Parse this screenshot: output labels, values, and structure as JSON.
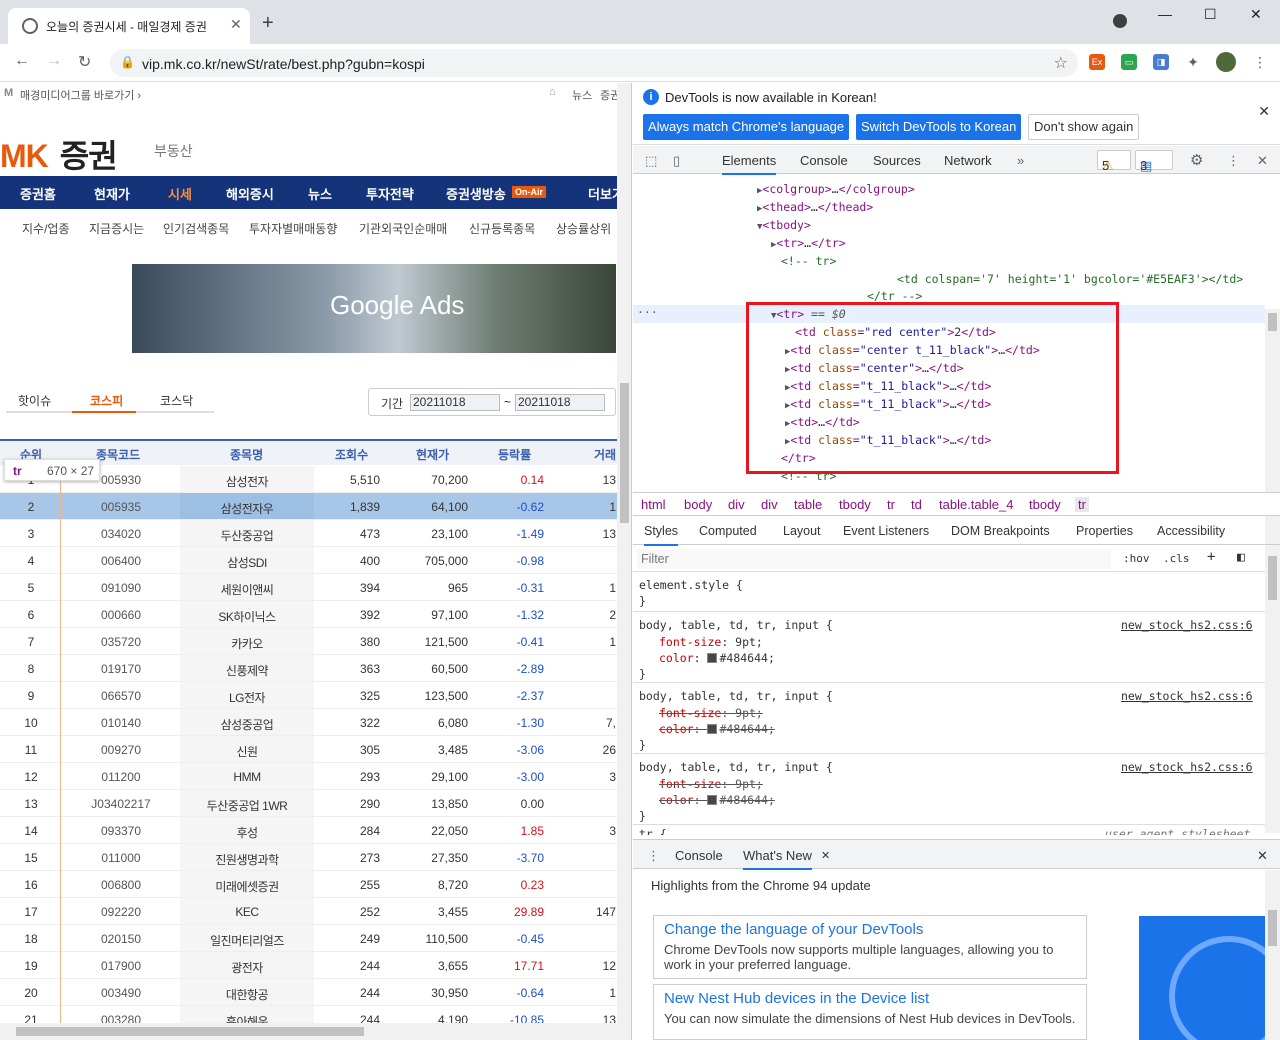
{
  "browser": {
    "tab_title": "오늘의 증권시세 - 매일경제 증권",
    "url": "vip.mk.co.kr/newSt/rate/best.php?gubn=kospi"
  },
  "page": {
    "top_link": "매경미디어그룹 바로가기 ›",
    "top_right": [
      "뉴스",
      "증권"
    ],
    "logo": "MK",
    "logo_kr": "증권",
    "estate": "부동산",
    "main_nav": [
      "증권홈",
      "현재가",
      "시세",
      "해외증시",
      "뉴스",
      "투자전략",
      "증권생방송",
      "더보기"
    ],
    "onair": "On-Air",
    "sub_nav": [
      "지수/업종",
      "지금증시는",
      "인기검색종목",
      "투자자별매매동향",
      "기관외국인순매매",
      "신규등록종목",
      "상승률상위"
    ],
    "ad_text": "Google Ads",
    "market_tabs": [
      "핫이슈",
      "코스피",
      "코스닥"
    ],
    "period_label": "기간",
    "date_from": "20211018",
    "date_to": "20211018",
    "tilde": "~",
    "headers": [
      "순위",
      "종목코드",
      "종목명",
      "조회수",
      "현재가",
      "등락률",
      "거래"
    ],
    "tooltip_tag": "tr",
    "tooltip_dim": "670 × 27",
    "rows": [
      [
        "1",
        "005930",
        "삼성전자",
        "5,510",
        "70,200",
        "0.14",
        "13",
        "up"
      ],
      [
        "2",
        "005935",
        "삼성전자우",
        "1,839",
        "64,100",
        "-0.62",
        "1",
        "dn"
      ],
      [
        "3",
        "034020",
        "두산중공업",
        "473",
        "23,100",
        "-1.49",
        "13",
        "dn"
      ],
      [
        "4",
        "006400",
        "삼성SDI",
        "400",
        "705,000",
        "-0.98",
        "",
        "dn"
      ],
      [
        "5",
        "091090",
        "세원이앤씨",
        "394",
        "965",
        "-0.31",
        "1",
        "dn"
      ],
      [
        "6",
        "000660",
        "SK하이닉스",
        "392",
        "97,100",
        "-1.32",
        "2",
        "dn"
      ],
      [
        "7",
        "035720",
        "카카오",
        "380",
        "121,500",
        "-0.41",
        "1",
        "dn"
      ],
      [
        "8",
        "019170",
        "신풍제약",
        "363",
        "60,500",
        "-2.89",
        "",
        "dn"
      ],
      [
        "9",
        "066570",
        "LG전자",
        "325",
        "123,500",
        "-2.37",
        "",
        "dn"
      ],
      [
        "10",
        "010140",
        "삼성중공업",
        "322",
        "6,080",
        "-1.30",
        "7,",
        "dn"
      ],
      [
        "11",
        "009270",
        "신원",
        "305",
        "3,485",
        "-3.06",
        "26",
        "dn"
      ],
      [
        "12",
        "011200",
        "HMM",
        "293",
        "29,100",
        "-3.00",
        "3",
        "dn"
      ],
      [
        "13",
        "J03402217",
        "두산중공업 1WR",
        "290",
        "13,850",
        "0.00",
        "",
        "eq"
      ],
      [
        "14",
        "093370",
        "후성",
        "284",
        "22,050",
        "1.85",
        "3",
        "up"
      ],
      [
        "15",
        "011000",
        "진원생명과학",
        "273",
        "27,350",
        "-3.70",
        "",
        "dn"
      ],
      [
        "16",
        "006800",
        "미래에셋증권",
        "255",
        "8,720",
        "0.23",
        "",
        "up"
      ],
      [
        "17",
        "092220",
        "KEC",
        "252",
        "3,455",
        "29.89",
        "147",
        "up"
      ],
      [
        "18",
        "020150",
        "일진머티리얼즈",
        "249",
        "110,500",
        "-0.45",
        "",
        "dn"
      ],
      [
        "19",
        "017900",
        "광전자",
        "244",
        "3,655",
        "17.71",
        "12",
        "up"
      ],
      [
        "20",
        "003490",
        "대한항공",
        "244",
        "30,950",
        "-0.64",
        "1",
        "dn"
      ],
      [
        "21",
        "003280",
        "흥아해운",
        "244",
        "4,190",
        "-10.85",
        "13",
        "dn"
      ]
    ]
  },
  "devtools": {
    "info_msg": "DevTools is now available in Korean!",
    "btn_match": "Always match Chrome's language",
    "btn_switch": "Switch DevTools to Korean",
    "btn_dont": "Don't show again",
    "tabs": [
      "Elements",
      "Console",
      "Sources",
      "Network"
    ],
    "warn_count": "5",
    "msg_count": "3",
    "breadcrumbs": [
      "html",
      "body",
      "div",
      "div",
      "table",
      "tbody",
      "tr",
      "td",
      "table.table_4",
      "tbody",
      "tr"
    ],
    "style_tabs": [
      "Styles",
      "Computed",
      "Layout",
      "Event Listeners",
      "DOM Breakpoints",
      "Properties",
      "Accessibility"
    ],
    "filter_placeholder": "Filter",
    "hov": ":hov",
    "cls": ".cls",
    "rule_selector": "body, table, td, tr, input {",
    "rule_src": "new_stock_hs2.css:6",
    "ua_src": "user agent stylesheet",
    "drawer_tabs": [
      "Console",
      "What's New"
    ],
    "wn_header": "Highlights from the Chrome 94 update",
    "card1_title": "Change the language of your DevTools",
    "card1_desc": "Chrome DevTools now supports multiple languages, allowing you to work in your preferred language.",
    "card2_title": "New Nest Hub devices in the Device list",
    "card2_desc": "You can now simulate the dimensions of Nest Hub devices in DevTools."
  }
}
